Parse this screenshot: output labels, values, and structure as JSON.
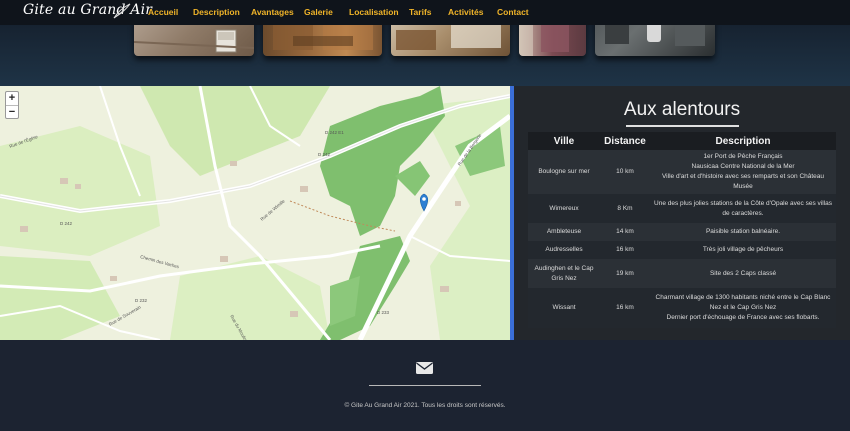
{
  "navbar": {
    "brand": "Gite au Grand Air",
    "links": [
      "Accueil",
      "Description",
      "Avantages",
      "Galerie",
      "Localisation",
      "Tarifs",
      "Activités",
      "Contact"
    ]
  },
  "map": {
    "zoom_in": "+",
    "zoom_out": "−",
    "road_labels": [
      "D 242 E1",
      "D 242",
      "D 232",
      "D 233",
      "D 242",
      "Rue de la Bergerie",
      "Rue de Wimille",
      "Rue de Souverain",
      "Chemin des Vaches",
      "Rue du Moulin",
      "Rue de l'Église"
    ]
  },
  "panel": {
    "title": "Aux alentours",
    "headers": [
      "Ville",
      "Distance",
      "Description"
    ],
    "rows": [
      {
        "ville": "Boulogne sur mer",
        "distance": "10 km",
        "description": [
          "1er Port de Pêche Français",
          "Nausicaa Centre National de la Mer",
          "Ville d'art et d'histoire avec ses remparts et son Château Musée"
        ]
      },
      {
        "ville": "Wimereux",
        "distance": "8 Km",
        "description": [
          "Une des plus jolies stations de la Côte d'Opale avec ses villas de caractères."
        ]
      },
      {
        "ville": "Ambleteuse",
        "distance": "14 km",
        "description": [
          "Paisible station balnéaire."
        ]
      },
      {
        "ville": "Audresselles",
        "distance": "16 km",
        "description": [
          "Très joli village de pêcheurs"
        ]
      },
      {
        "ville": "Audinghen et le Cap Gris Nez",
        "distance": "19 km",
        "description": [
          "Site des 2 Caps classé"
        ]
      },
      {
        "ville": "Wissant",
        "distance": "16 km",
        "description": [
          "Charmant village de 1300 habitants niché entre le Cap Blanc Nez et le Cap Gris Nez",
          "Dernier port d'échouage de France avec ses flobarts."
        ]
      }
    ]
  },
  "footer": {
    "copyright": "© Gite Au Grand Air 2021. Tous les droits sont réservés.",
    "icon": "envelope-icon"
  },
  "colors": {
    "nav_link": "#f0b429",
    "background": "#1c2331",
    "map_divider": "#3b6fd8"
  }
}
